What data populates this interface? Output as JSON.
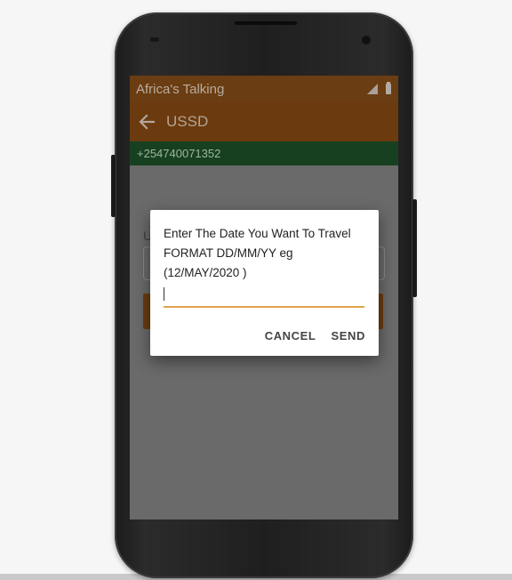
{
  "status_bar": {
    "carrier": "Africa's Talking"
  },
  "toolbar": {
    "title": "USSD"
  },
  "phone_number": "+254740071352",
  "background_form": {
    "label": "U"
  },
  "dialog": {
    "message": "Enter The Date You Want To Travel\nFORMAT DD/MM/YY eg\n(12/MAY/2020 )",
    "input_value": "",
    "cancel_label": "CANCEL",
    "send_label": "SEND"
  },
  "colors": {
    "status_bar": "#6b3d12",
    "toolbar": "#6b3a0e",
    "phone_bar": "#174020",
    "input_underline": "#e0a34a"
  },
  "icons": {
    "back": "arrow-left-icon",
    "signal": "signal-icon",
    "battery": "battery-icon"
  }
}
